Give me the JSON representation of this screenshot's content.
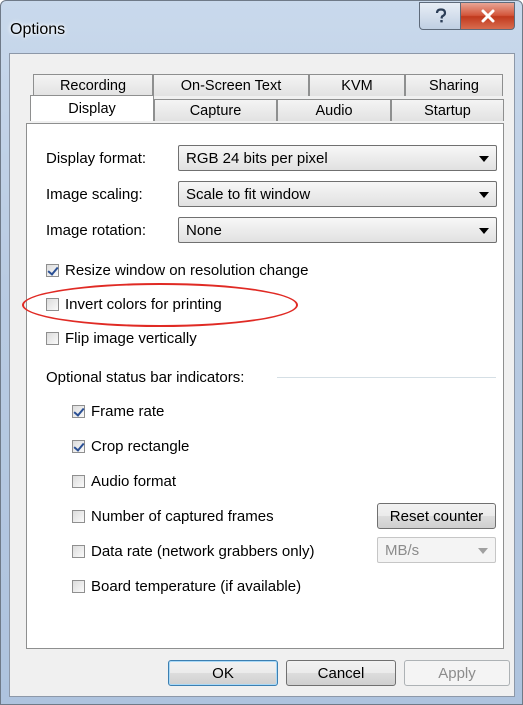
{
  "window": {
    "title": "Options"
  },
  "tabs_back": [
    "Recording",
    "On-Screen Text",
    "KVM",
    "Sharing"
  ],
  "tabs_front": [
    "Display",
    "Capture",
    "Audio",
    "Startup"
  ],
  "display": {
    "format": {
      "label": "Display format:",
      "value": "RGB 24 bits per pixel"
    },
    "scaling": {
      "label": "Image scaling:",
      "value": "Scale to fit window"
    },
    "rotation": {
      "label": "Image rotation:",
      "value": "None"
    }
  },
  "options": {
    "resize": {
      "label": "Resize window on resolution change",
      "checked": true
    },
    "invert": {
      "label": "Invert colors for printing",
      "checked": false
    },
    "flip": {
      "label": "Flip image vertically",
      "checked": false
    }
  },
  "status_bar": {
    "heading": "Optional status bar indicators:",
    "frame_rate": {
      "label": "Frame rate",
      "checked": true
    },
    "crop_rect": {
      "label": "Crop rectangle",
      "checked": true
    },
    "audio_format": {
      "label": "Audio format",
      "checked": false
    },
    "captured_frames": {
      "label": "Number of captured frames",
      "checked": false
    },
    "data_rate": {
      "label": "Data rate (network grabbers only)",
      "checked": false
    },
    "board_temp": {
      "label": "Board temperature (if available)",
      "checked": false
    },
    "reset_counter": "Reset counter",
    "rate_unit": "MB/s"
  },
  "buttons": {
    "ok": "OK",
    "cancel": "Cancel",
    "apply": "Apply"
  },
  "colors": {
    "annotation": "#e02a24",
    "close_button": "#c0391d",
    "check": "#2a4f94"
  }
}
